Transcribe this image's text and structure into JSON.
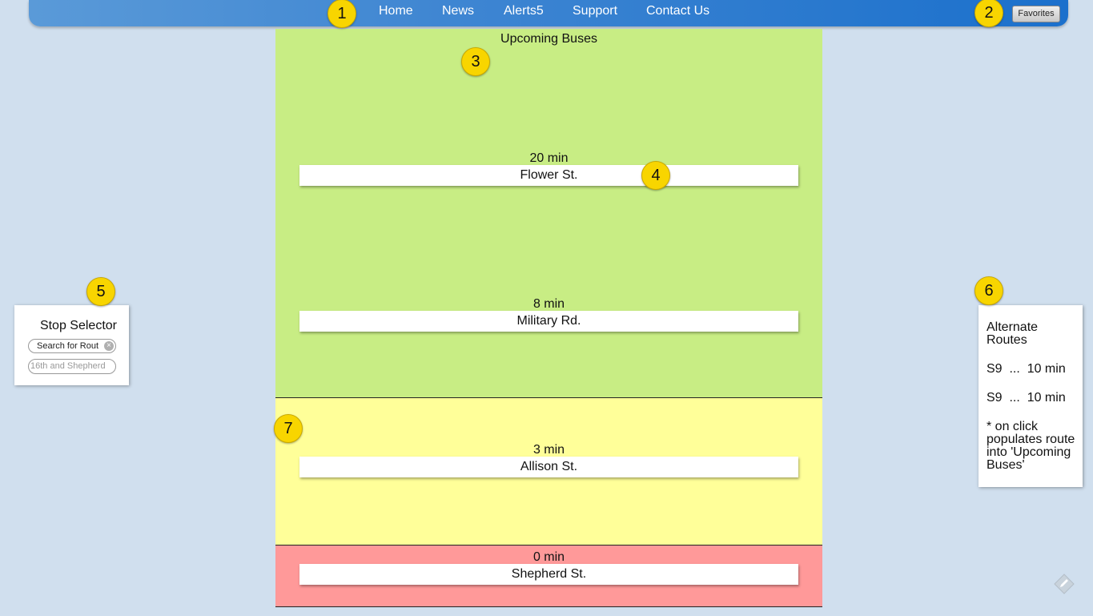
{
  "nav": {
    "links": [
      "Home",
      "News",
      "Alerts5",
      "Support",
      "Contact Us"
    ],
    "favorites_label": "Favorites"
  },
  "markers": [
    "1",
    "2",
    "3",
    "4",
    "5",
    "6",
    "7"
  ],
  "upcoming": {
    "title": "Upcoming Buses",
    "buses": [
      {
        "time": "20 min",
        "stop": "Flower St."
      },
      {
        "time": "8 min",
        "stop": "Military Rd."
      },
      {
        "time": "3 min",
        "stop": "Allison St."
      },
      {
        "time": "0 min",
        "stop": "Shepherd St."
      }
    ],
    "zone_colors": {
      "far": "#c8ed84",
      "near": "#ffff99",
      "arriving": "#ff9999"
    }
  },
  "stop_selector": {
    "title": "Stop Selector",
    "search_value": "Search for Rout",
    "stop_placeholder": "16th and Shepherd"
  },
  "alternate_routes": {
    "title_line1": "Alternate",
    "title_line2": "Routes",
    "routes": [
      "S9  ...  10 min",
      "S9  ...  10 min"
    ],
    "note_lines": [
      "* on click",
      "populates route",
      "into 'Upcoming",
      "Buses'"
    ]
  },
  "icons": {
    "clear": "clear-icon",
    "pencil": "pencil-icon"
  }
}
